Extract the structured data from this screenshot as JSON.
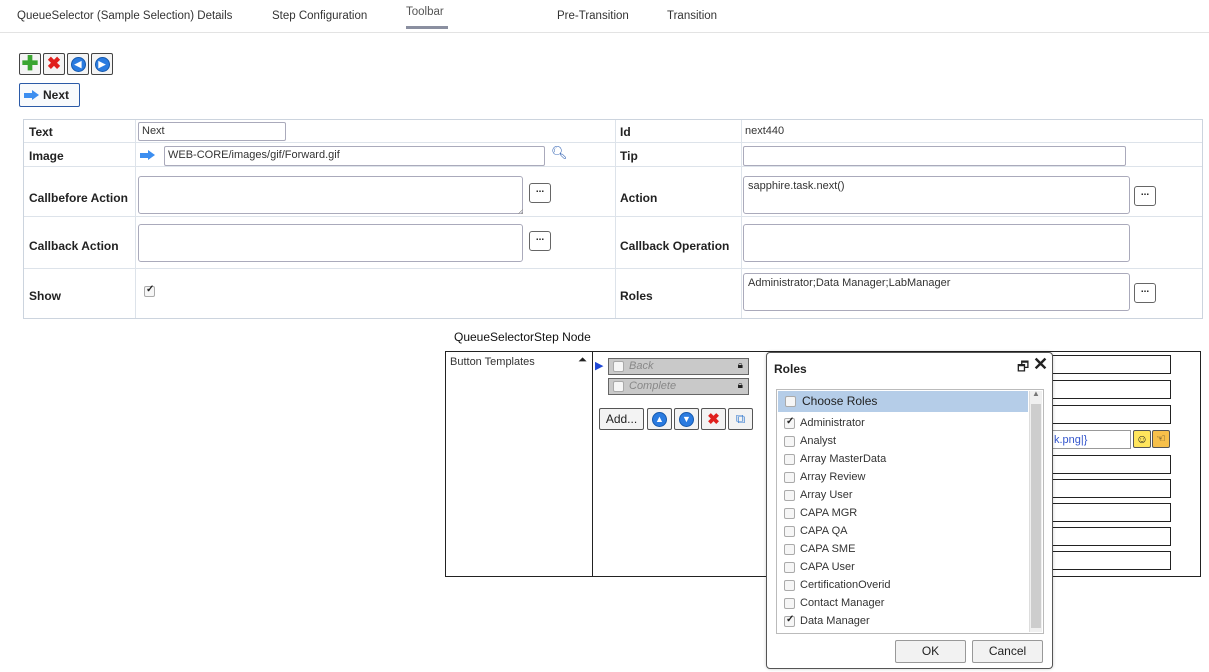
{
  "tabs": [
    {
      "label": "QueueSelector (Sample Selection) Details"
    },
    {
      "label": "Step Configuration"
    },
    {
      "label": "Toolbar"
    },
    {
      "label": "Pre-Transition"
    },
    {
      "label": "Transition"
    }
  ],
  "toolbar": {
    "add_icon": "plus-icon",
    "delete_icon": "x-icon",
    "left_icon": "arrow-left-circle-icon",
    "right_icon": "arrow-right-circle-icon"
  },
  "preview_button": {
    "label": "Next",
    "icon": "arrow-right-icon"
  },
  "props": {
    "text_label": "Text",
    "text_value": "Next",
    "id_label": "Id",
    "id_value": "next440",
    "image_label": "Image",
    "image_value": "WEB-CORE/images/gif/Forward.gif",
    "tip_label": "Tip",
    "tip_value": "",
    "callbefore_label": "Callbefore Action",
    "callbefore_value": "",
    "action_label": "Action",
    "action_value": "sapphire.task.next()",
    "callback_label": "Callback Action",
    "callback_value": "",
    "callback_op_label": "Callback Operation",
    "callback_op_value": "",
    "show_label": "Show",
    "show_checked": true,
    "roles_label": "Roles",
    "roles_value": "Administrator;Data Manager;LabManager",
    "ellipsis": "..."
  },
  "diagram": {
    "title": "QueueSelectorStep Node",
    "button_templates": "Button Templates",
    "buttons": [
      {
        "label": "Back",
        "checked": false
      },
      {
        "label": "Complete",
        "checked": false
      }
    ],
    "add_label": "Add...",
    "partial_text": "k.png|}"
  },
  "roles_dialog": {
    "title": "Roles",
    "header": "Choose Roles",
    "options": [
      {
        "label": "Administrator",
        "checked": true
      },
      {
        "label": "Analyst",
        "checked": false
      },
      {
        "label": "Array MasterData",
        "checked": false
      },
      {
        "label": "Array Review",
        "checked": false
      },
      {
        "label": "Array User",
        "checked": false
      },
      {
        "label": "CAPA MGR",
        "checked": false
      },
      {
        "label": "CAPA QA",
        "checked": false
      },
      {
        "label": "CAPA SME",
        "checked": false
      },
      {
        "label": "CAPA User",
        "checked": false
      },
      {
        "label": "CertificationOverid",
        "checked": false
      },
      {
        "label": "Contact Manager",
        "checked": false
      },
      {
        "label": "Data Manager",
        "checked": true
      }
    ],
    "ok_label": "OK",
    "cancel_label": "Cancel"
  },
  "colors": {
    "accent": "#2a7be0",
    "selection": "#b5cde8",
    "danger": "#e0201d",
    "success": "#3aa531"
  }
}
